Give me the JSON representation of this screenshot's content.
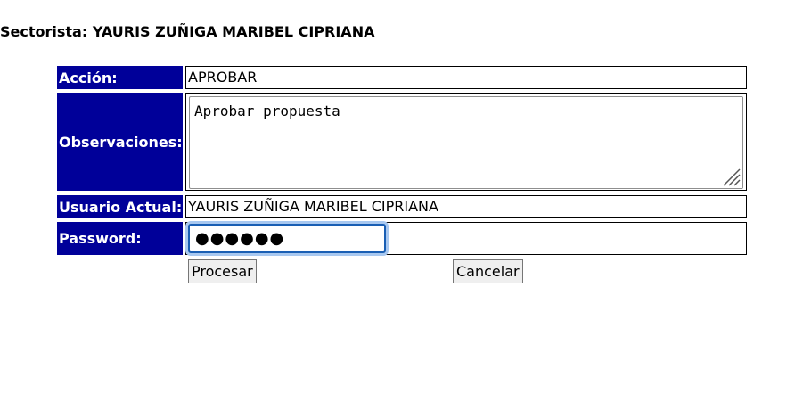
{
  "header": {
    "title": "Sectorista: YAURIS ZUÑIGA MARIBEL CIPRIANA"
  },
  "form": {
    "accion": {
      "label": "Acción:",
      "value": "APROBAR"
    },
    "observaciones": {
      "label": "Observaciones:",
      "value": "Aprobar propuesta"
    },
    "usuario": {
      "label": "Usuario Actual:",
      "value": "YAURIS ZUÑIGA MARIBEL CIPRIANA"
    },
    "password": {
      "label": "Password:",
      "masked_value": "●●●●●●"
    }
  },
  "buttons": {
    "procesar": "Procesar",
    "cancelar": "Cancelar"
  },
  "colors": {
    "label_background": "#000099",
    "label_text": "#ffffff",
    "focus_border": "#1a5fb4"
  }
}
